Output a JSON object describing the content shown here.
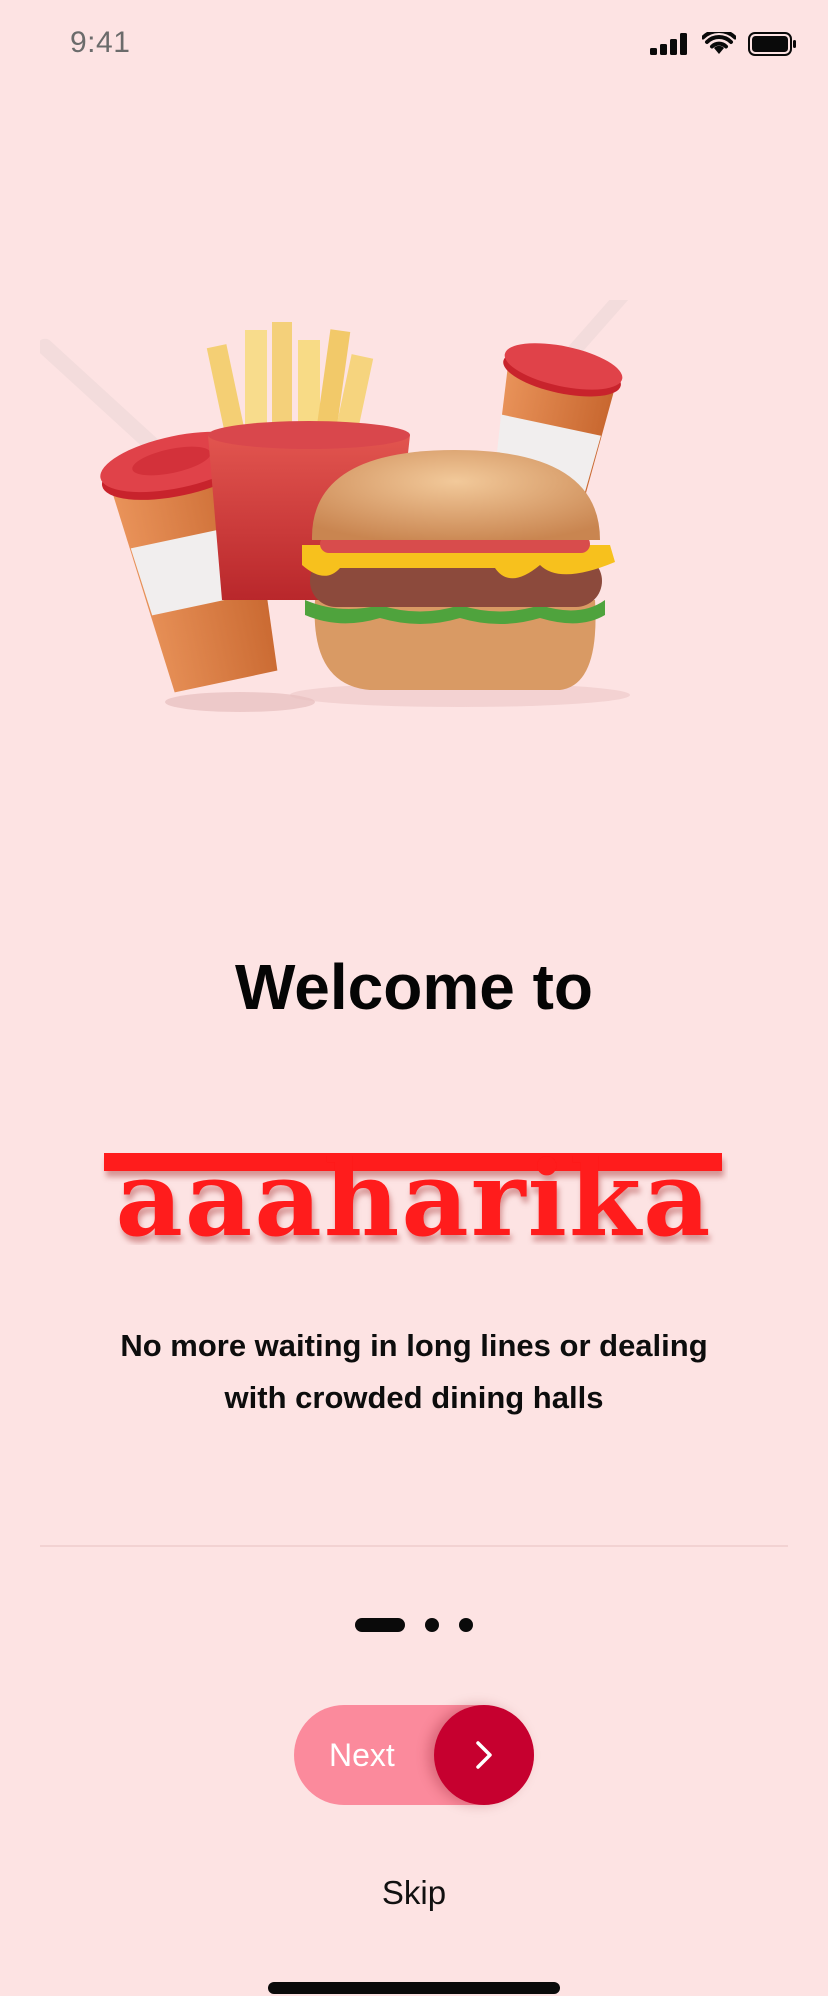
{
  "status_bar": {
    "time": "9:41"
  },
  "onboarding": {
    "welcome": "Welcome to",
    "brand_name": "aaaharika",
    "subtitle_line1": "No more waiting in long lines or dealing",
    "subtitle_line2": "with crowded dining halls",
    "page_indicator": {
      "current": 1,
      "total": 3
    },
    "next_label": "Next",
    "skip_label": "Skip"
  },
  "colors": {
    "background": "#fde3e3",
    "brand_red": "#ff1a1a",
    "next_pill": "#fb8a9c",
    "next_circle": "#c6002f"
  },
  "icons": [
    "signal-icon",
    "wifi-icon",
    "battery-icon",
    "chevron-right-icon"
  ]
}
